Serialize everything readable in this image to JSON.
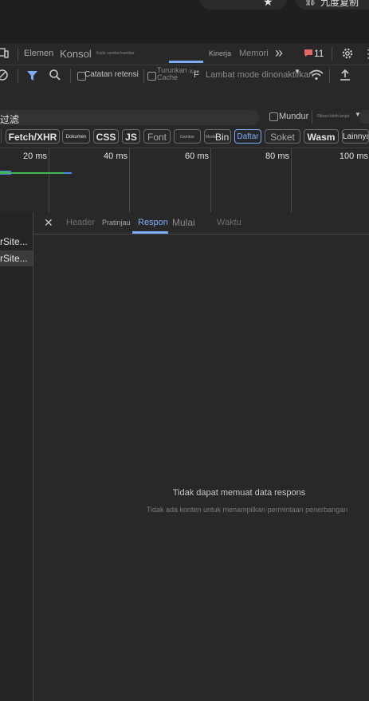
{
  "browser": {
    "star_glyph": "★",
    "ext_glyph": "⛓",
    "ext_label": "九度复制"
  },
  "tabs": {
    "elements": "Elemen",
    "console": "Konsol",
    "sources": "Kode sumber/sumber",
    "performance": "Kinerja",
    "memory": "Memori",
    "more": "»",
    "issues_count": "11"
  },
  "toolbar": {
    "preserve_log": "Catatan retensi",
    "disable_cache_line1": "Turunkan",
    "disable_cache_line2": "Cache",
    "throttle_prefix": "F",
    "throttle": "Lambat mode dinonaktifkan",
    "throttle_sub": "Kec."
  },
  "filter": {
    "value": "过滤",
    "invert": "Mundur",
    "hide_ext": "Filtrasi lebih lanjut"
  },
  "types": {
    "fetch": "Fetch/XHR",
    "doc": "Dokumen",
    "css": "CSS",
    "js": "JS",
    "font": "Font",
    "img": "Gambar",
    "media": "Media",
    "manifest": "Bin",
    "manifest_prefix": "Media",
    "ws": "Soket",
    "wasm": "Wasm",
    "other": "Lainnya",
    "blocked": "Daftar"
  },
  "timeline": {
    "labels": [
      "20 ms",
      "40 ms",
      "60 ms",
      "80 ms",
      "100 ms"
    ]
  },
  "requests": [
    {
      "name": "rSite..."
    },
    {
      "name": "rSite..."
    }
  ],
  "detail": {
    "close": "✕",
    "headers": "Header",
    "preview": "Pratinjau",
    "response": "Respon",
    "initiator": "Mulai",
    "timing": "Waktu",
    "empty_title": "Tidak dapat memuat data respons",
    "empty_sub": "Tidak ada konten untuk menampilkan permintaan penerbangan"
  },
  "colors": {
    "accent": "#7cacf8",
    "issue_red": "#e46962",
    "bar_green": "#3fb950",
    "bar_blue": "#4a86e8"
  }
}
